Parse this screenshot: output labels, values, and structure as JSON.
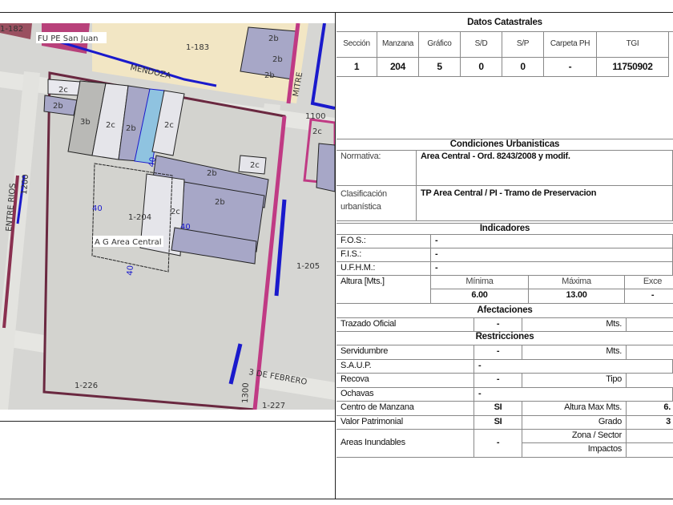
{
  "map": {
    "labels": {
      "fu": "FU PE San Juan",
      "ag": "A G Area Central",
      "l182": "1-182",
      "l183": "1-183",
      "l204": "1-204",
      "l205": "1-205",
      "l226": "1-226",
      "l227": "1-227",
      "mendoza": "MENDOZA",
      "mitre": "MITRE",
      "entre_rios": "ENTRE RIOS",
      "tres_febrero": "3 DE FEBRERO",
      "n1100": "1100",
      "n1200": "1200",
      "n1300": "1300",
      "d40": "40",
      "z2b": "2b",
      "z2c": "2c",
      "z3b": "3b"
    }
  },
  "datos": {
    "title": "Datos Catastrales",
    "headers": [
      "Sección",
      "Manzana",
      "Gráfico",
      "S/D",
      "S/P",
      "Carpeta PH",
      "TGI"
    ],
    "values": [
      "1",
      "204",
      "5",
      "0",
      "0",
      "-",
      "11750902"
    ]
  },
  "condiciones": {
    "title": "Condiciones Urbanisticas",
    "normativa_label": "Normativa:",
    "normativa": "Area Central - Ord. 8243/2008 y modif.",
    "clasif_label1": "Clasificación",
    "clasif_label2": "urbanística",
    "clasif": "TP Area Central / PI - Tramo de Preservacion"
  },
  "indicadores": {
    "title": "Indicadores",
    "fos_label": "F.O.S.:",
    "fos": "-",
    "fis_label": "F.I.S.:",
    "fis": "-",
    "ufhm_label": "U.F.H.M.:",
    "ufhm": "-",
    "altura_label": "Altura [Mts.]",
    "minima_label": "Mínima",
    "maxima_label": "Máxima",
    "exce_label": "Exce",
    "minima": "6.00",
    "maxima": "13.00",
    "exce": "-"
  },
  "afectaciones": {
    "title": "Afectaciones",
    "trazado_label": "Trazado Oficial",
    "trazado": "-",
    "mts": "Mts."
  },
  "restricciones": {
    "title": "Restricciones",
    "servidumbre_label": "Servidumbre",
    "servidumbre": "-",
    "mts": "Mts.",
    "saup_label": "S.A.U.P.",
    "saup": "-",
    "recova_label": "Recova",
    "recova": "-",
    "tipo": "Tipo",
    "ochavas_label": "Ochavas",
    "ochavas": "-",
    "centro_label": "Centro de Manzana",
    "centro": "SI",
    "altura_max": "Altura Max Mts.",
    "altura_max_val": "6.",
    "valor_label": "Valor Patrimonial",
    "valor": "SI",
    "grado": "Grado",
    "grado_val": "3",
    "areas_label": "Areas Inundables",
    "areas": "-",
    "zona": "Zona / Sector",
    "impactos": "Impactos"
  }
}
